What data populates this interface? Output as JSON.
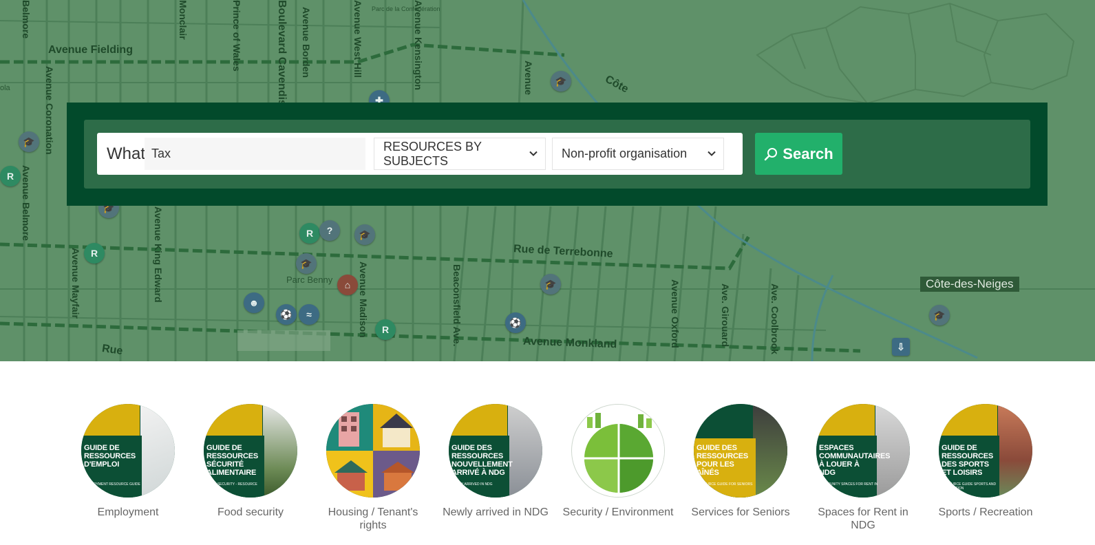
{
  "map": {
    "streets": {
      "fielding": "Avenue Fielding",
      "terrebonne": "Rue de Terrebonne",
      "monkland": "Avenue Monkland",
      "belmore": "Avenue Belmore",
      "belmore_top": "Belmore",
      "coronation": "Avenue Coronation",
      "mayfair": "Avenue Mayfair",
      "king_edward": "Avenue King Edward",
      "madison": "Avenue Madison",
      "beaconsfield": "Beaconsfield Ave.",
      "oxford": "Avenue Oxford",
      "girouard": "Ave. Girouard",
      "coolbrook": "Ave. Coolbrook",
      "kensington": "Avenue Kensington",
      "cavendish": "Boulevard Cavendish",
      "borden": "Avenue Borden",
      "west_hill": "Avenue West Hill",
      "monclair": "Monclair",
      "prince_wales": "Prince of Wales",
      "cote": "Côte",
      "avenue": "Avenue",
      "rue": "Rue",
      "parc_benny": "Parc Benny",
      "parc_confed": "Parc de la Confédération",
      "ola": "ola"
    },
    "neighbourhood": "Côte-des-Neiges"
  },
  "search": {
    "what_label": "What",
    "what_value": "Tax",
    "subjects_value": "RESOURCES BY SUBJECTS",
    "org_value": "Non-profit organisation",
    "button_label": "Search"
  },
  "categories": [
    {
      "label": "Employment",
      "cover_title": "GUIDE DE RESSOURCES D'EMPLOI",
      "cover_sub": "EMPLOYMENT RESOURCE GUIDE"
    },
    {
      "label": "Food security",
      "cover_title": "GUIDE DE RESSOURCES SÉCURITÉ ALIMENTAIRE",
      "cover_sub": "FOOD SECURITY - RESOURCE GUIDE"
    },
    {
      "label": "Housing / Tenant's rights",
      "cover_title": "",
      "cover_sub": ""
    },
    {
      "label": "Newly arrived in NDG",
      "cover_title": "GUIDE DES RESSOURCES NOUVELLEMENT ARRIVÉ À NDG",
      "cover_sub": "NEWLY ARRIVED IN NDG"
    },
    {
      "label": "Security / Environment",
      "cover_title": "",
      "cover_sub": ""
    },
    {
      "label": "Services for Seniors",
      "cover_title": "GUIDE DES RESSOURCES POUR LES AÎNÉS",
      "cover_sub": "RESOURCE GUIDE FOR SENIORS"
    },
    {
      "label": "Spaces for Rent in NDG",
      "cover_title": "ESPACES COMMUNAUTAIRES À LOUER À NDG",
      "cover_sub": "COMMUNITY SPACES FOR RENT IN NDG"
    },
    {
      "label": "Sports / Recreation",
      "cover_title": "GUIDE DE RESSOURCES DES SPORTS ET LOISIRS",
      "cover_sub": "RESOURCE GUIDE SPORTS AND RECREATION"
    }
  ],
  "colors": {
    "panel_dark": "#024a2b",
    "panel_mid": "#2d6c48",
    "button_green": "#22b06b",
    "map_bg": "#5f9169",
    "cover_gold": "#d8b00f",
    "cover_green": "#0c4f35"
  }
}
